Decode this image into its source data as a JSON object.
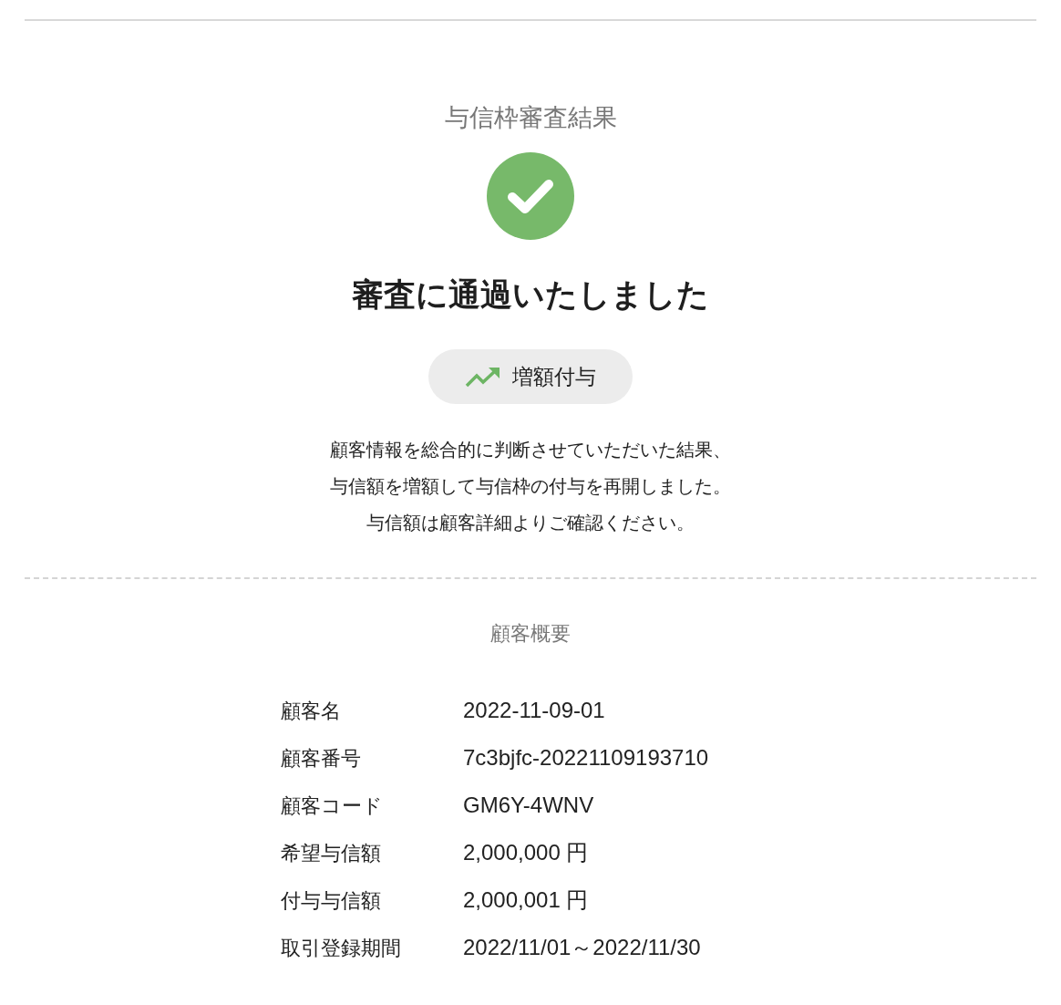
{
  "title": "与信枠審査結果",
  "result": {
    "kind": "passed",
    "heading": "審査に通過いたしました"
  },
  "badge": {
    "kind": "increase",
    "label": "増額付与"
  },
  "message": [
    "顧客情報を総合的に判断させていただいた結果、",
    "与信額を増額して与信枠の付与を再開しました。",
    "与信額は顧客詳細よりご確認ください。"
  ],
  "summary": {
    "title": "顧客概要",
    "rows": [
      {
        "label": "顧客名",
        "value": "2022-11-09-01"
      },
      {
        "label": "顧客番号",
        "value": "7c3bjfc-20221109193710"
      },
      {
        "label": "顧客コード",
        "value": "GM6Y-4WNV"
      },
      {
        "label": "希望与信額",
        "value": "2,000,000 円"
      },
      {
        "label": "付与与信額",
        "value": "2,000,001 円"
      },
      {
        "label": "取引登録期間",
        "value": "2022/11/01～2022/11/30"
      }
    ]
  }
}
